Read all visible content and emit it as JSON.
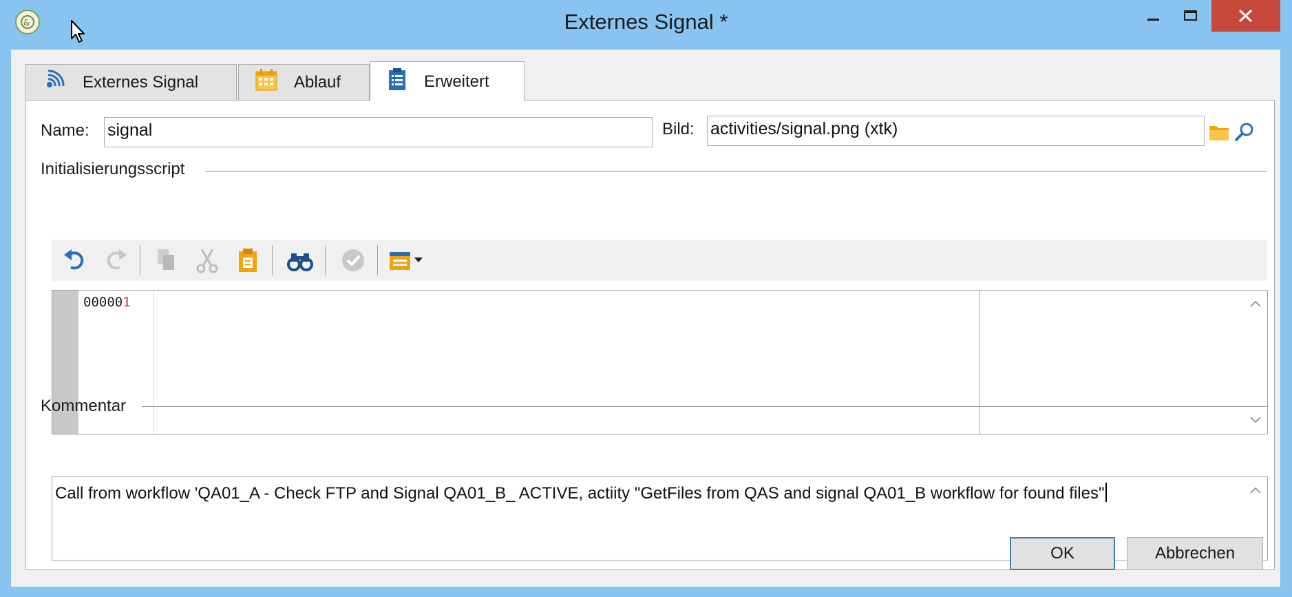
{
  "window": {
    "title": "Externes Signal *"
  },
  "tabs": [
    {
      "label": "Externes Signal",
      "icon": "signal-icon"
    },
    {
      "label": "Ablauf",
      "icon": "calendar-icon"
    },
    {
      "label": "Erweitert",
      "icon": "clipboard-icon",
      "active": true
    }
  ],
  "form": {
    "name_label": "Name:",
    "name_value": "signal",
    "image_label": "Bild:",
    "image_value": "activities/signal.png (xtk)"
  },
  "script_section": {
    "title": "Initialisierungsscript",
    "toolbar": [
      "undo-icon",
      "redo-icon",
      "copy-icon",
      "cut-icon",
      "paste-icon",
      "find-icon",
      "validate-icon",
      "insert-menu-icon"
    ],
    "line_number_prefix": "00000",
    "line_number_last": "1"
  },
  "comment_section": {
    "title": "Kommentar",
    "text": "Call from workflow 'QA01_A - Check FTP and Signal QA01_B_ ACTIVE, actiity \"GetFiles from QAS and signal QA01_B workflow for found files\""
  },
  "buttons": {
    "ok": "OK",
    "cancel": "Abbrechen"
  },
  "colors": {
    "titlebar": "#89c3f0",
    "close_button": "#c7473a",
    "ok_border": "#3c7fb1",
    "accent_orange": "#f0a30a",
    "accent_blue": "#2a6ebb"
  }
}
